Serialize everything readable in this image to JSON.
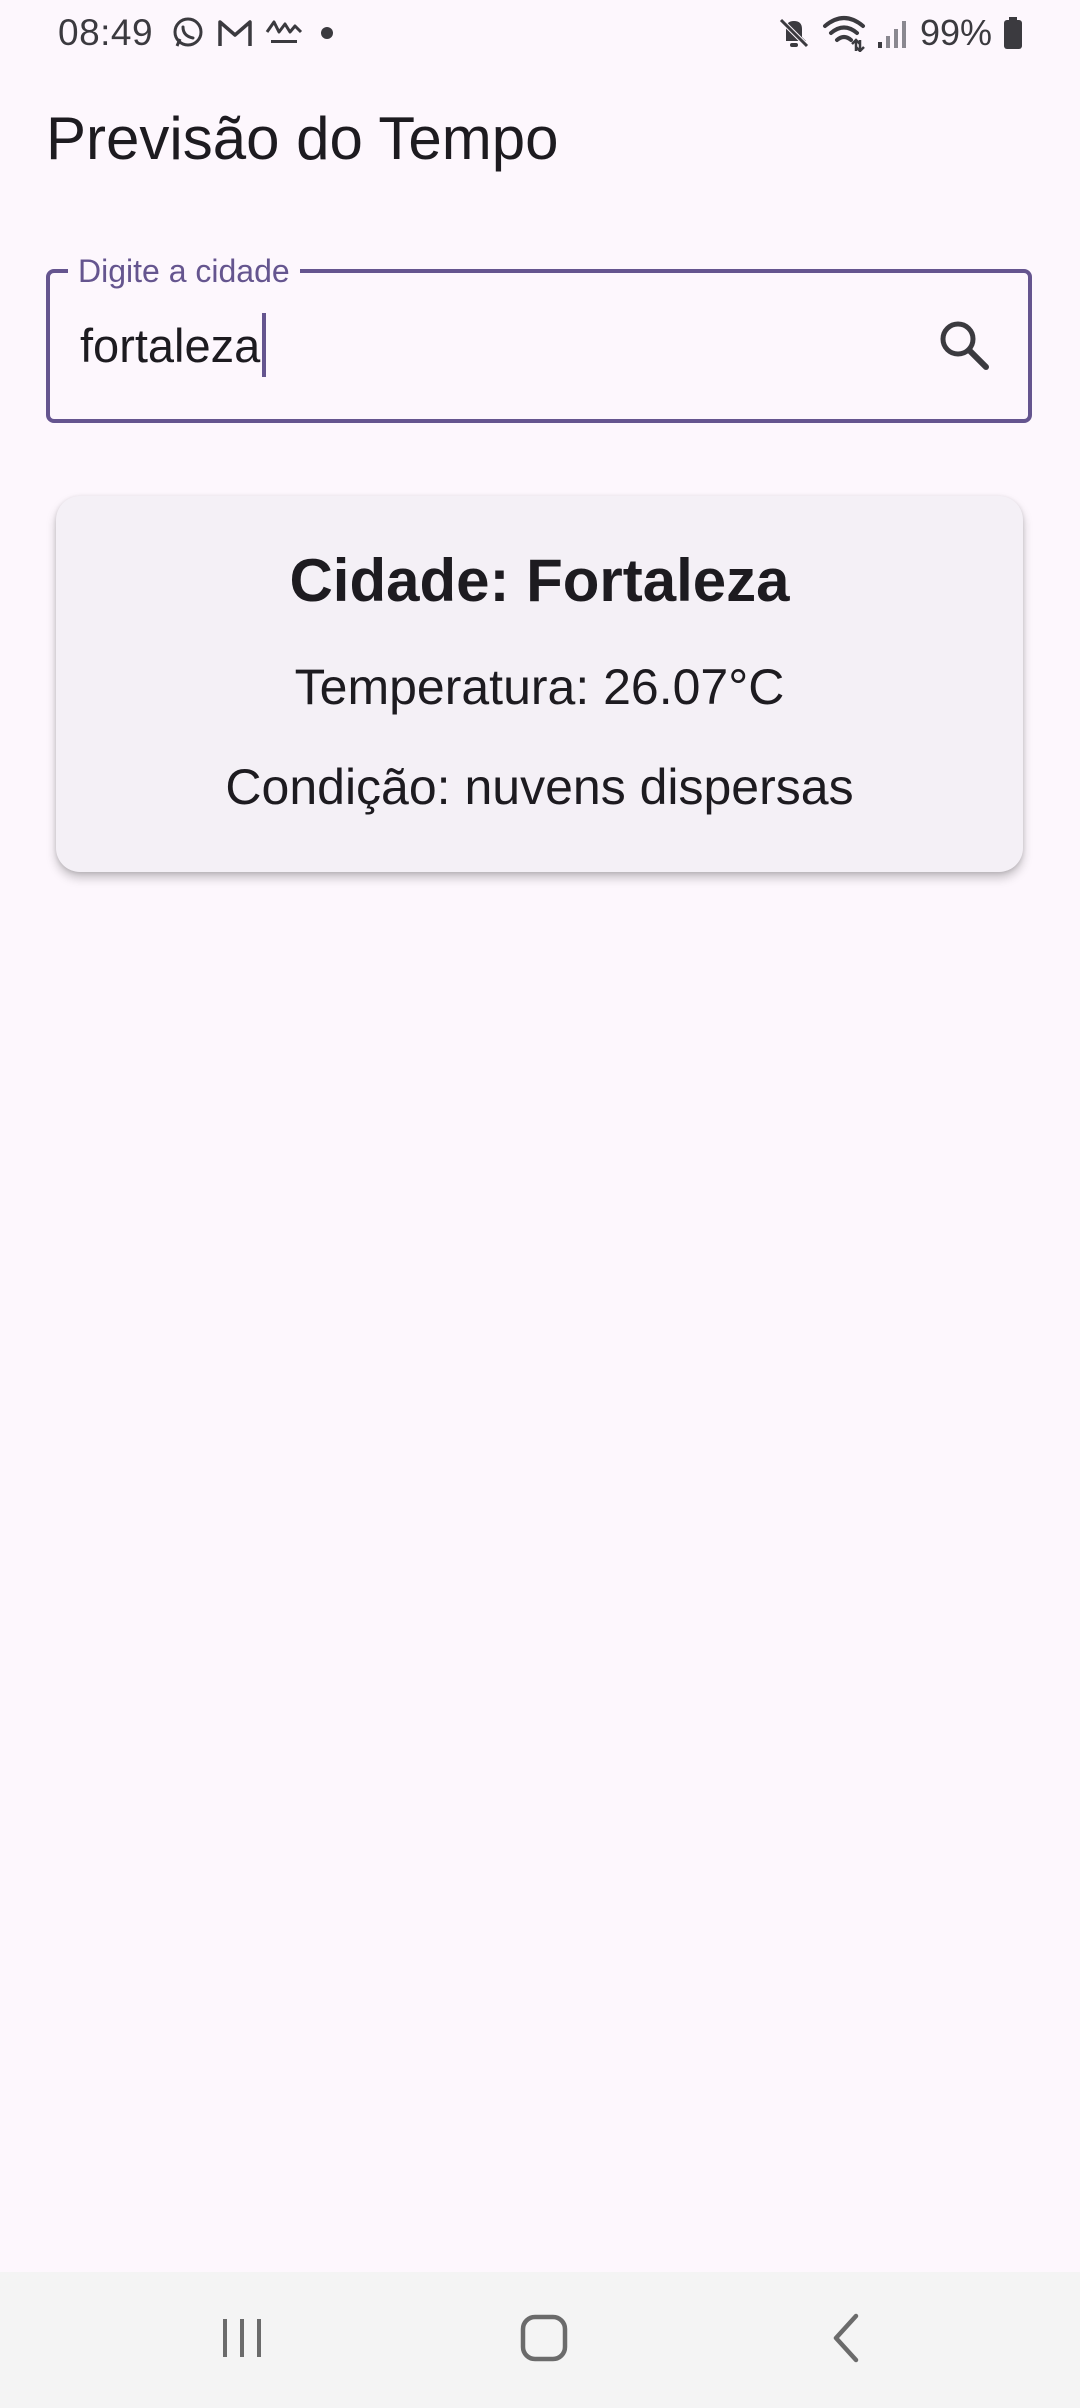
{
  "status_bar": {
    "time": "08:49",
    "notification_icons": [
      "whatsapp-icon",
      "gmail-icon",
      "app-icon",
      "dot-icon"
    ],
    "system_icons": [
      "mute-icon",
      "wifi-icon",
      "signal-icon"
    ],
    "battery": "99%"
  },
  "app": {
    "title": "Previsão do Tempo"
  },
  "search": {
    "label": "Digite a cidade",
    "value": "fortaleza",
    "button_icon": "search-icon"
  },
  "weather": {
    "city": "Cidade: Fortaleza",
    "temperature": "Temperatura: 26.07°C",
    "condition": "Condição: nuvens dispersas"
  },
  "navigation": {
    "buttons": [
      "recents-icon",
      "home-icon",
      "back-icon"
    ]
  },
  "colors": {
    "background": "#fdf7fd",
    "accent": "#65558f",
    "card": "#f4f0f6",
    "text": "#1d1b20",
    "nav_bar": "#f4f4f4"
  }
}
